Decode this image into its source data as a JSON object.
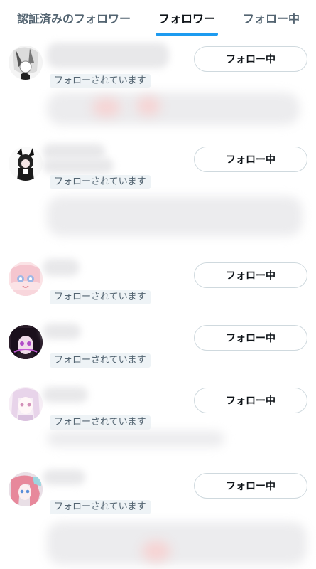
{
  "tabs": [
    {
      "label": "認証済みのフォロワー",
      "active": false
    },
    {
      "label": "フォロワー",
      "active": true
    },
    {
      "label": "フォロー中",
      "active": false
    }
  ],
  "colors": {
    "accent": "#1d9bf0",
    "text": "#0f1419",
    "muted": "#536471",
    "border": "#cfd9de"
  },
  "followers": [
    {
      "follows_you_label": "フォローされています",
      "button_label": "フォロー中"
    },
    {
      "follows_you_label": "フォローされています",
      "button_label": "フォロー中"
    },
    {
      "follows_you_label": "フォローされています",
      "button_label": "フォロー中"
    },
    {
      "follows_you_label": "フォローされています",
      "button_label": "フォロー中"
    },
    {
      "follows_you_label": "フォローされています",
      "button_label": "フォロー中"
    },
    {
      "follows_you_label": "フォローされています",
      "button_label": "フォロー中"
    }
  ]
}
